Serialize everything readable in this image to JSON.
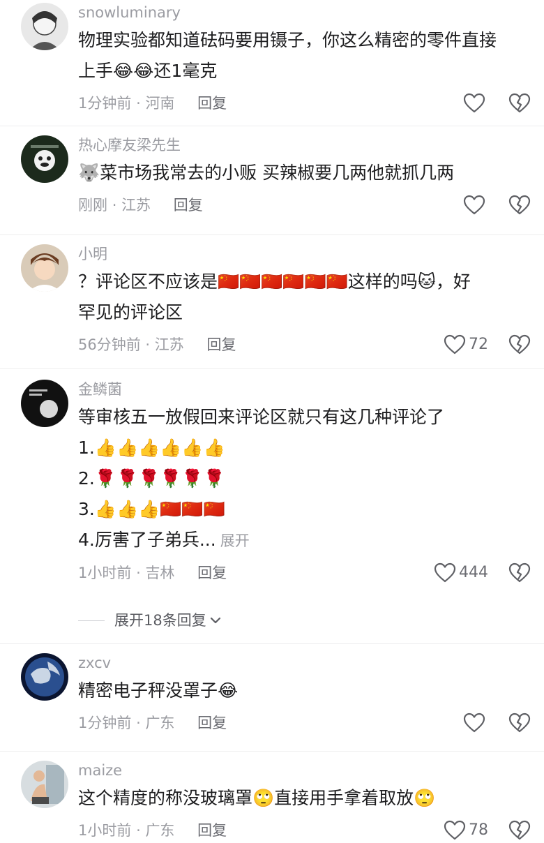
{
  "comments": [
    {
      "user": "snowluminary",
      "lines": [
        "物理实验都知道砝码要用镊子，你这么精密的零件直接",
        "上手😂😂还1毫克"
      ],
      "time": "1分钟前",
      "location": "河南",
      "reply": "回复",
      "likes": ""
    },
    {
      "user": "热心摩友梁先生",
      "lines": [
        "🐺菜市场我常去的小贩 买辣椒要几两他就抓几两"
      ],
      "time": "刚刚",
      "location": "江苏",
      "reply": "回复",
      "likes": ""
    },
    {
      "user": "小明",
      "lines": [
        "？评论区不应该是🇨🇳🇨🇳🇨🇳🇨🇳🇨🇳🇨🇳这样的吗🐱，好",
        "罕见的评论区"
      ],
      "time": "56分钟前",
      "location": "江苏",
      "reply": "回复",
      "likes": "72"
    },
    {
      "user": "金鳞菌",
      "lines": [
        "等审核五一放假回来评论区就只有这几种评论了",
        "1.👍👍👍👍👍👍",
        "2.🌹🌹🌹🌹🌹🌹",
        "3.👍👍👍🇨🇳🇨🇳🇨🇳",
        "4.厉害了子弟兵..."
      ],
      "expand": "展开",
      "time": "1小时前",
      "location": "吉林",
      "reply": "回复",
      "likes": "444"
    },
    {
      "user": "zxcv",
      "lines": [
        "精密电子秤没罩子😂"
      ],
      "time": "1分钟前",
      "location": "广东",
      "reply": "回复",
      "likes": ""
    },
    {
      "user": "maize",
      "lines": [
        "这个精度的称没玻璃罩🙄直接用手拿着取放🙄"
      ],
      "time": "1小时前",
      "location": "广东",
      "reply": "回复",
      "likes": "78"
    }
  ],
  "expand_replies": "展开18条回复",
  "separator": "·",
  "colors": {
    "meta": "#9b9ca2",
    "text": "#1d1d1f",
    "reply": "#6b6c72"
  }
}
